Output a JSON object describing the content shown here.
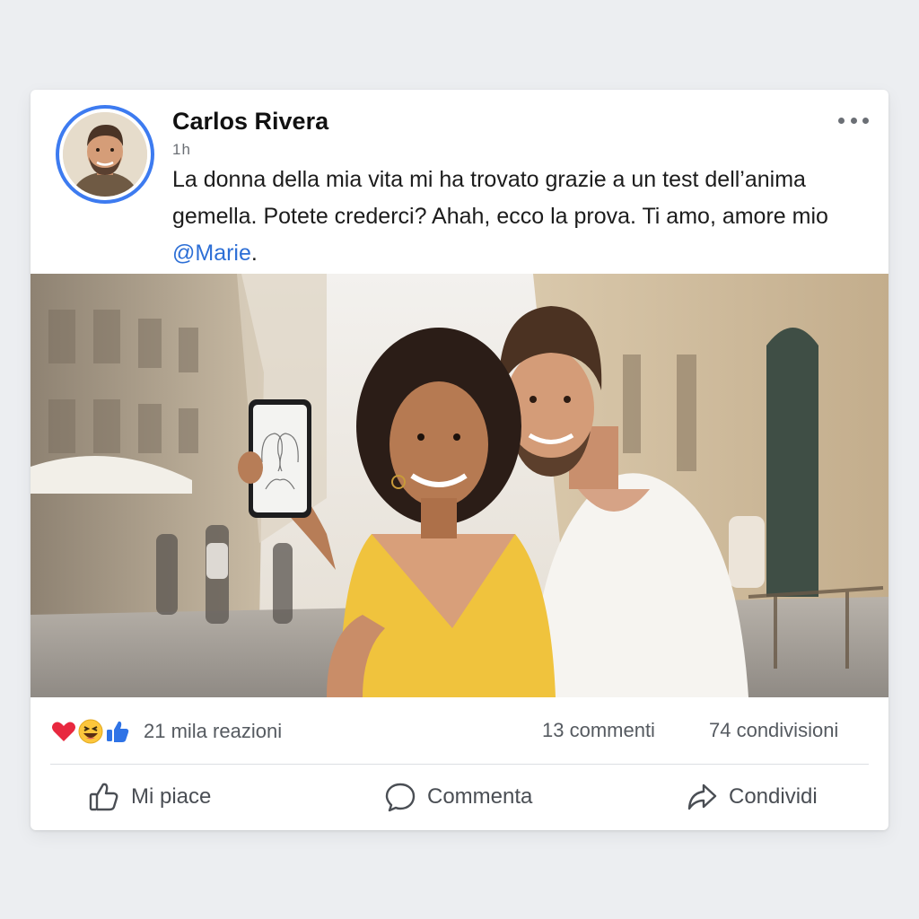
{
  "post": {
    "author": "Carlos Rivera",
    "timestamp": "1h",
    "text_before_mention": "La donna della mia vita mi ha trovato grazie a un test dell’anima gemella. Potete crederci? Ahah, ecco la prova. Ti amo, amore mio ",
    "mention": "@Marie",
    "text_after_mention": "."
  },
  "stats": {
    "reactions": "21 mila reazioni",
    "comments": "13 commenti",
    "shares": "74 condivisioni",
    "reaction_icons": [
      "heart-icon",
      "laughing-emoji-icon",
      "thumbs-up-icon"
    ]
  },
  "actions": {
    "like": "Mi piace",
    "comment": "Commenta",
    "share": "Condividi"
  },
  "colors": {
    "accent": "#3d7bf0",
    "mention": "#2d6fd6",
    "heart": "#e8283f",
    "like_blue": "#2f73e6"
  }
}
